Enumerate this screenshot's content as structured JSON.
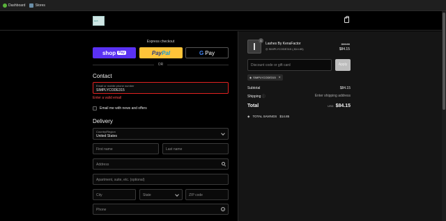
{
  "bookmarks": [
    {
      "label": "Dashboard",
      "icon": "dashboard-icon",
      "color": "#59b33b"
    },
    {
      "label": "Stores",
      "icon": "stores-icon",
      "color": "#6a8ea8"
    }
  ],
  "header": {
    "logo_text": "lash"
  },
  "express": {
    "title": "Express checkout",
    "shop_label": "shop",
    "shop_pay": "Pay",
    "paypal_pay": "Pay",
    "paypal_pal": "Pal",
    "gpay_g": "G",
    "gpay_label": "Pay",
    "or": "OR"
  },
  "contact": {
    "title": "Contact",
    "email_label": "Email or mobile phone number",
    "email_value": "SIMPLYCODE315",
    "error": "Enter a valid email",
    "newsletter": "Email me with news and offers"
  },
  "delivery": {
    "title": "Delivery",
    "country_label": "Country/Region",
    "country_value": "United States",
    "first_name": "First name",
    "last_name": "Last name",
    "address": "Address",
    "apartment": "Apartment, suite, etc. (optional)",
    "city": "City",
    "state": "State",
    "zip": "ZIP code",
    "phone": "Phone"
  },
  "summary": {
    "qty": "1",
    "product_name": "Lashes By KenaFactor",
    "product_code": "SIMPLYCODE315 (-$14.85)",
    "old_price": "$99.00",
    "new_price": "$84.15",
    "discount_placeholder": "Discount code or gift card",
    "apply": "Apply",
    "code_tag": "SIMPLYCODE315",
    "subtotal_label": "Subtotal",
    "subtotal_value": "$84.15",
    "shipping_label": "Shipping",
    "shipping_value": "Enter shipping address",
    "total_label": "Total",
    "currency": "USD",
    "total_value": "$84.15",
    "savings_label": "TOTAL SAVINGS",
    "savings_value": "$14.85"
  }
}
